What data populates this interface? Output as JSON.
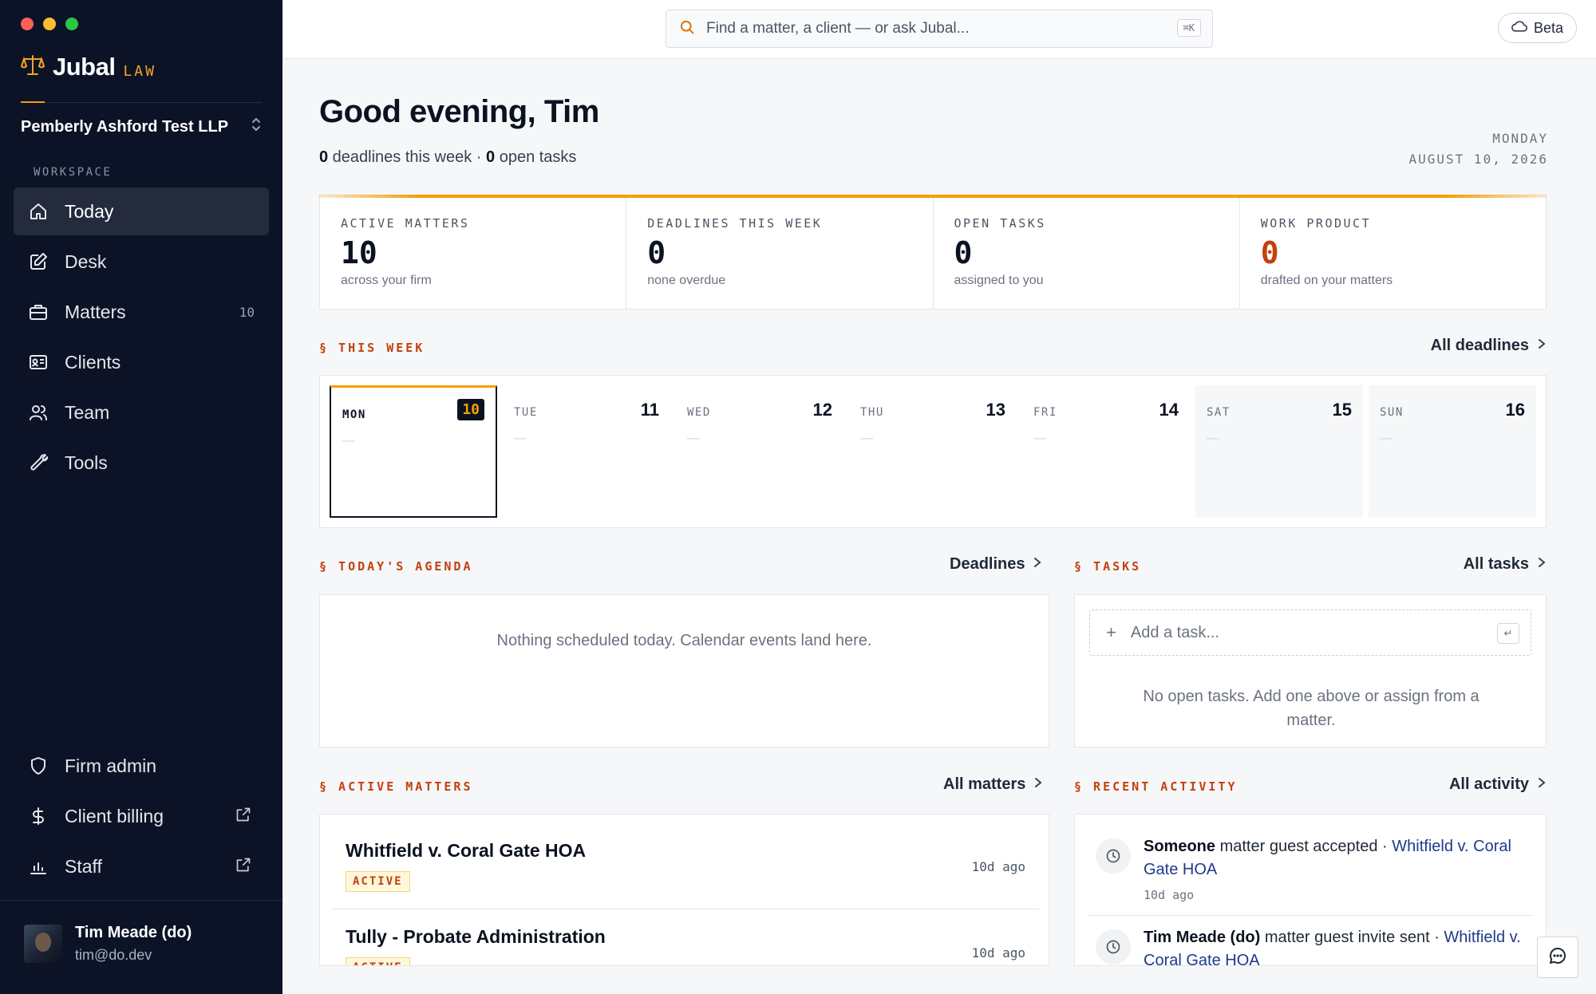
{
  "window": {
    "traffic_lights": [
      "#ff5f57",
      "#febc2e",
      "#28c840"
    ]
  },
  "brand": {
    "name": "Jubal",
    "tag": "LAW",
    "accent": "#f59e0b"
  },
  "firm": {
    "name": "Pemberly Ashford Test LLP"
  },
  "sidebar": {
    "section_label": "WORKSPACE",
    "items": [
      {
        "label": "Today",
        "icon": "home-icon",
        "active": true
      },
      {
        "label": "Desk",
        "icon": "edit-icon"
      },
      {
        "label": "Matters",
        "icon": "briefcase-icon",
        "count": "10"
      },
      {
        "label": "Clients",
        "icon": "id-card-icon"
      },
      {
        "label": "Team",
        "icon": "users-icon"
      },
      {
        "label": "Tools",
        "icon": "wrench-icon"
      }
    ],
    "bottom_items": [
      {
        "label": "Firm admin",
        "icon": "shield-icon"
      },
      {
        "label": "Client billing",
        "icon": "dollar-icon",
        "external": true
      },
      {
        "label": "Staff",
        "icon": "bar-chart-icon",
        "external": true
      }
    ]
  },
  "user": {
    "name": "Tim Meade (do)",
    "email": "tim@do.dev"
  },
  "topbar": {
    "search_placeholder": "Find a matter, a client — or ask Jubal...",
    "search_shortcut": "⌘K",
    "beta_label": "Beta"
  },
  "header": {
    "greeting": "Good evening, Tim",
    "deadlines_count": "0",
    "deadlines_text": " deadlines this week · ",
    "tasks_count": "0",
    "tasks_text": " open tasks",
    "date_day": "MONDAY",
    "date_full": "AUGUST 10, 2026"
  },
  "stats": [
    {
      "label": "ACTIVE MATTERS",
      "value": "10",
      "sub": "across your firm"
    },
    {
      "label": "DEADLINES THIS WEEK",
      "value": "0",
      "sub": "none overdue"
    },
    {
      "label": "OPEN TASKS",
      "value": "0",
      "sub": "assigned to you"
    },
    {
      "label": "WORK PRODUCT",
      "value": "0",
      "sub": "drafted on your matters",
      "highlight": "#c2410c"
    }
  ],
  "this_week": {
    "label": "§ THIS WEEK",
    "link": "All deadlines",
    "days": [
      {
        "name": "MON",
        "num": "10",
        "today": true,
        "dash": "—"
      },
      {
        "name": "TUE",
        "num": "11",
        "dash": "—"
      },
      {
        "name": "WED",
        "num": "12",
        "dash": "—"
      },
      {
        "name": "THU",
        "num": "13",
        "dash": "—"
      },
      {
        "name": "FRI",
        "num": "14",
        "dash": "—"
      },
      {
        "name": "SAT",
        "num": "15",
        "weekend": true,
        "dash": "—"
      },
      {
        "name": "SUN",
        "num": "16",
        "weekend": true,
        "dash": "—"
      }
    ]
  },
  "agenda": {
    "label": "§ TODAY'S AGENDA",
    "link": "Deadlines",
    "empty": "Nothing scheduled today. Calendar events land here."
  },
  "tasks": {
    "label": "§ TASKS",
    "link": "All tasks",
    "input_placeholder": "Add a task...",
    "enter_key": "↵",
    "empty": "No open tasks. Add one above or assign from a matter."
  },
  "active_matters": {
    "label": "§ ACTIVE MATTERS",
    "link": "All matters",
    "rows": [
      {
        "title": "Whitfield v. Coral Gate HOA",
        "status": "ACTIVE",
        "time": "10d ago"
      },
      {
        "title": "Tully - Probate Administration",
        "status": "ACTIVE",
        "time": "10d ago"
      }
    ]
  },
  "recent_activity": {
    "label": "§ RECENT ACTIVITY",
    "link": "All activity",
    "rows": [
      {
        "actor": "Someone",
        "action": " matter guest accepted · ",
        "target": "Whitfield v. Coral Gate HOA",
        "time": "10d ago"
      },
      {
        "actor": "Tim Meade (do)",
        "action": " matter guest invite sent · ",
        "target": "Whitfield v. Coral Gate HOA",
        "time": ""
      }
    ]
  }
}
